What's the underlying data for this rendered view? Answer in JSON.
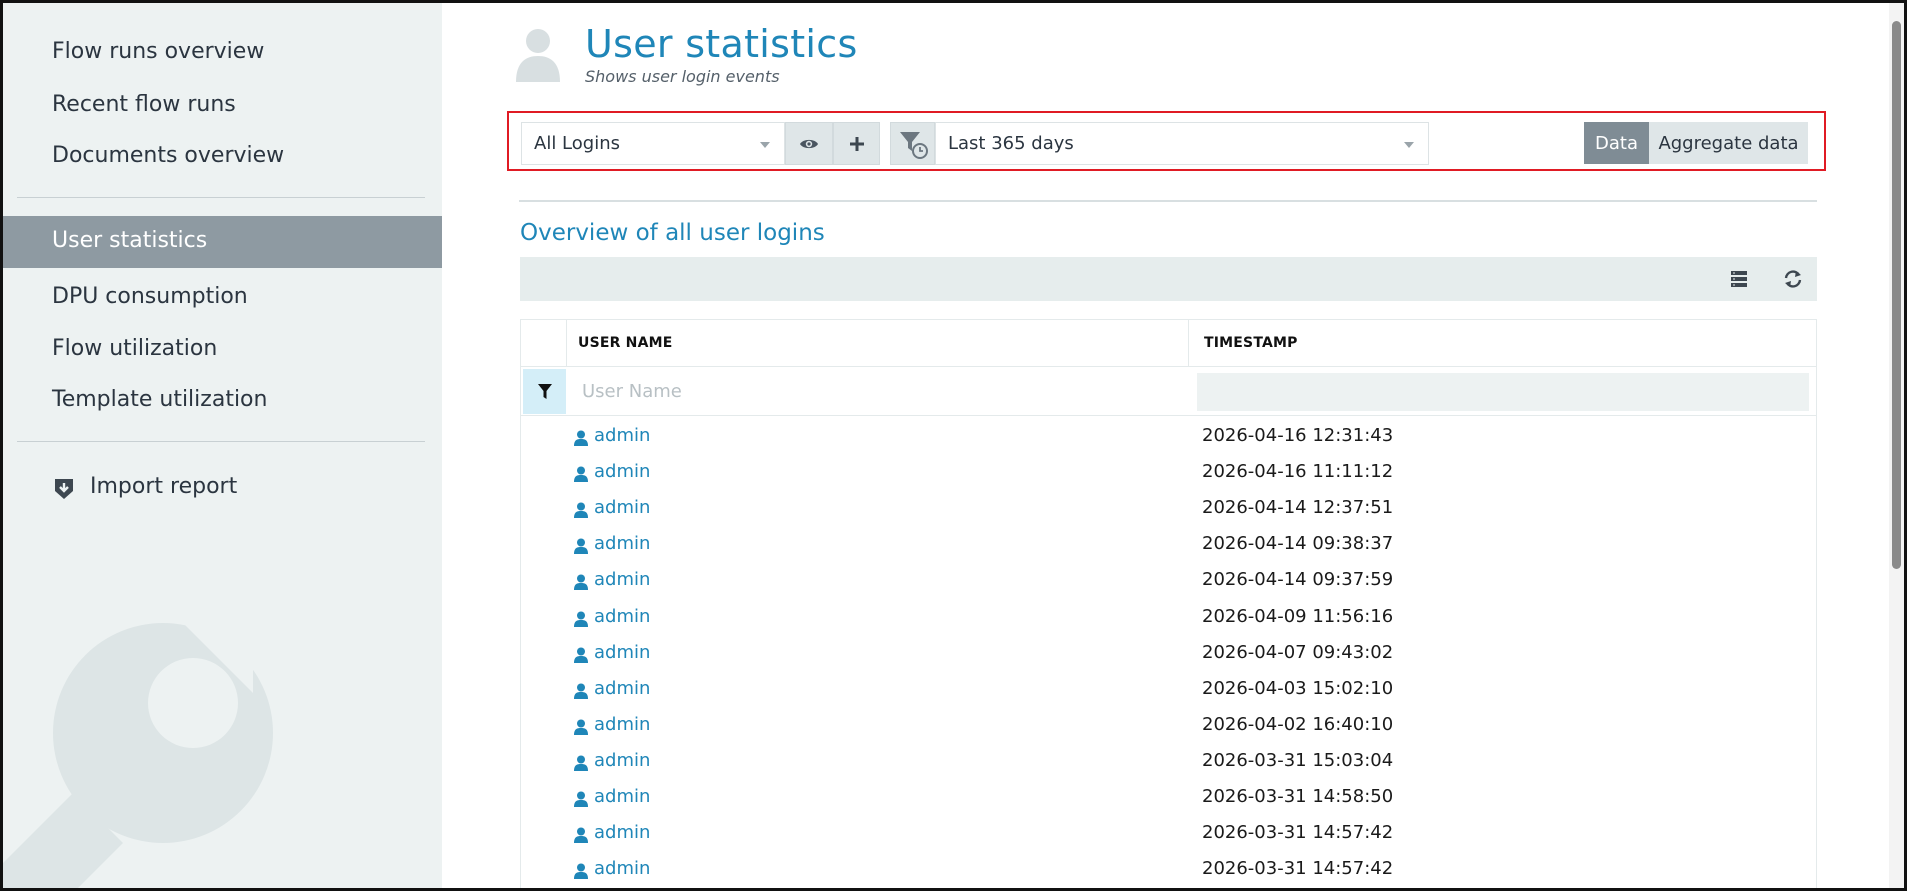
{
  "sidebar": {
    "items": [
      {
        "label": "Flow runs overview"
      },
      {
        "label": "Recent flow runs"
      },
      {
        "label": "Documents overview"
      },
      {
        "label": "User statistics",
        "active": true
      },
      {
        "label": "DPU consumption"
      },
      {
        "label": "Flow utilization"
      },
      {
        "label": "Template utilization"
      }
    ],
    "import_report": {
      "label": "Import report",
      "icon": "download-shield-icon"
    }
  },
  "header": {
    "title": "User statistics",
    "subtitle": "Shows user login events",
    "icon": "user-avatar-icon"
  },
  "toolbar": {
    "view_select": {
      "value": "All Logins"
    },
    "view_button_icon": "eye-icon",
    "add_button_icon": "plus-icon",
    "time_filter_icon": "filter-clock-icon",
    "period_select": {
      "value": "Last 365 days"
    },
    "data_tab": "Data",
    "aggregate_tab": "Aggregate data",
    "active_tab": "Data"
  },
  "section": {
    "title": "Overview of all user logins"
  },
  "grid_toolbar": {
    "columns_icon": "columns-icon",
    "refresh_icon": "refresh-icon"
  },
  "table": {
    "headers": {
      "user_name": "USER NAME",
      "timestamp": "TIMESTAMP"
    },
    "filter": {
      "user_name_placeholder": "User Name"
    },
    "rows": [
      {
        "user": "admin",
        "timestamp": "2026-04-16 12:31:43"
      },
      {
        "user": "admin",
        "timestamp": "2026-04-16 11:11:12"
      },
      {
        "user": "admin",
        "timestamp": "2026-04-14 12:37:51"
      },
      {
        "user": "admin",
        "timestamp": "2026-04-14 09:38:37"
      },
      {
        "user": "admin",
        "timestamp": "2026-04-14 09:37:59"
      },
      {
        "user": "admin",
        "timestamp": "2026-04-09 11:56:16"
      },
      {
        "user": "admin",
        "timestamp": "2026-04-07 09:43:02"
      },
      {
        "user": "admin",
        "timestamp": "2026-04-03 15:02:10"
      },
      {
        "user": "admin",
        "timestamp": "2026-04-02 16:40:10"
      },
      {
        "user": "admin",
        "timestamp": "2026-03-31 15:03:04"
      },
      {
        "user": "admin",
        "timestamp": "2026-03-31 14:58:50"
      },
      {
        "user": "admin",
        "timestamp": "2026-03-31 14:57:42"
      },
      {
        "user": "admin",
        "timestamp": "2026-03-31 14:57:42"
      }
    ]
  },
  "colors": {
    "accent": "#1f86b8",
    "sidebar_bg": "#edf2f2",
    "sidebar_active": "#8e9aa2",
    "highlight_outline": "#e01b24"
  }
}
